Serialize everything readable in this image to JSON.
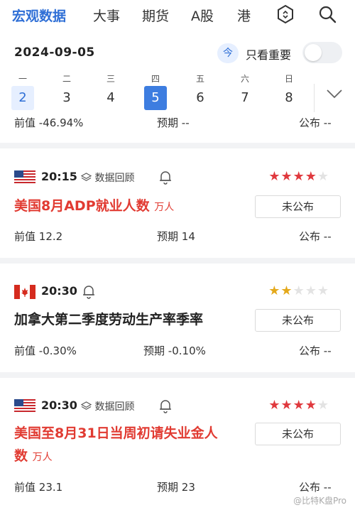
{
  "nav": {
    "tabs": [
      "宏观数据",
      "大事",
      "期货",
      "A股",
      "港"
    ],
    "icons": [
      "hexagon-icon",
      "search-icon"
    ],
    "accent": "#2f6fd6"
  },
  "date_bar": {
    "date": "2024-09-05",
    "today_label": "今",
    "important_only_label": "只看重要",
    "important_only_on": false
  },
  "week": {
    "weekdays": [
      "一",
      "二",
      "三",
      "四",
      "五",
      "六",
      "日"
    ],
    "days": [
      "2",
      "3",
      "4",
      "5",
      "6",
      "7",
      "8"
    ],
    "selected": "5"
  },
  "partial_event": {
    "prev_label": "前值",
    "prev_value": "-46.94%",
    "expected_label": "预期",
    "expected_value": "--",
    "actual_label": "公布",
    "actual_value": "--"
  },
  "events": [
    {
      "flag": "us-flag-icon",
      "time": "20:15",
      "review_label": "数据回顾",
      "stars": 4,
      "title": "美国8月ADP就业人数",
      "unit": "万人",
      "status": "未公布",
      "prev_label": "前值",
      "prev_value": "12.2",
      "expected_label": "预期",
      "expected_value": "14",
      "actual_label": "公布",
      "actual_value": "--"
    },
    {
      "flag": "canada-flag-icon",
      "time": "20:30",
      "stars": 2,
      "title": "加拿大第二季度劳动生产率季率",
      "status": "未公布",
      "prev_label": "前值",
      "prev_value": "-0.30%",
      "expected_label": "预期",
      "expected_value": "-0.10%",
      "actual_label": "公布",
      "actual_value": "--"
    },
    {
      "flag": "us-flag-icon",
      "time": "20:30",
      "review_label": "数据回顾",
      "stars": 4,
      "title_line1": "美国至8月31日当周初请失业金人",
      "title_line2": "数",
      "unit": "万人",
      "status": "未公布",
      "prev_label": "前值",
      "prev_value": "23.1",
      "expected_label": "预期",
      "expected_value": "23",
      "actual_label": "公布",
      "actual_value": "--"
    }
  ],
  "watermark": "@比特K盘Pro"
}
